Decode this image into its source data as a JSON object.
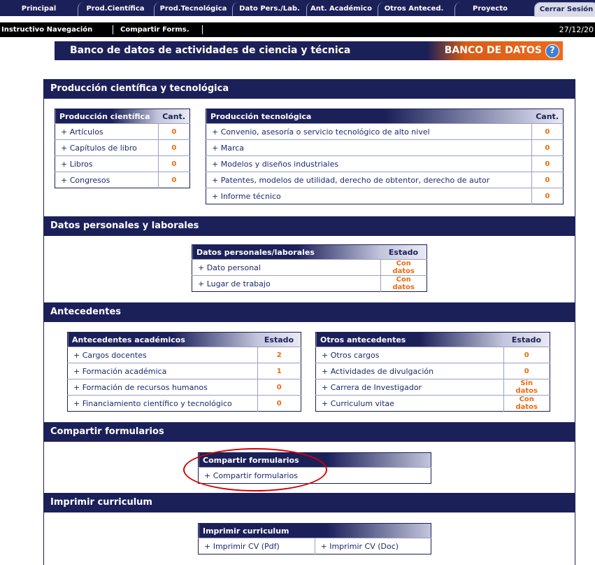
{
  "tabs": [
    {
      "label": "Principal"
    },
    {
      "label": "Prod.Científica"
    },
    {
      "label": "Prod.Tecnológica"
    },
    {
      "label": "Dato Pers./Lab."
    },
    {
      "label": "Ant. Académico"
    },
    {
      "label": "Otros Anteced."
    },
    {
      "label": "Proyecto"
    },
    {
      "label": "Cerrar Sesión"
    }
  ],
  "subbar": {
    "instructivo": "Instructivo Navegación",
    "compartir": "Compartir Forms.",
    "date": "27/12/20"
  },
  "banner": {
    "title": "Banco de datos de actividades de ciencia y técnica",
    "right_label": "BANCO DE DATOS",
    "help": "?"
  },
  "sections": {
    "prod": "Producción científica y tecnológica",
    "datos": "Datos personales y laborales",
    "antecedentes": "Antecedentes",
    "compartir": "Compartir formularios",
    "imprimir": "Imprimir curriculum"
  },
  "prod_cientifica": {
    "header": "Producción científica",
    "col": "Cant.",
    "rows": [
      {
        "label": "+ Artículos",
        "value": "0"
      },
      {
        "label": "+ Capítulos de libro",
        "value": "0"
      },
      {
        "label": "+ Libros",
        "value": "0"
      },
      {
        "label": "+ Congresos",
        "value": "0"
      }
    ]
  },
  "prod_tecnologica": {
    "header": "Producción tecnológica",
    "col": "Cant.",
    "rows": [
      {
        "label": "+ Convenio, asesoría o servicio tecnológico de alto nivel",
        "value": "0"
      },
      {
        "label": "+ Marca",
        "value": "0"
      },
      {
        "label": "+ Modelos y diseños industriales",
        "value": "0"
      },
      {
        "label": "+ Patentes, modelos de utilidad, derecho de obtentor, derecho de autor",
        "value": "0"
      },
      {
        "label": "+ Informe técnico",
        "value": "0"
      }
    ]
  },
  "datos_personales": {
    "header": "Datos personales/laborales",
    "col": "Estado",
    "rows": [
      {
        "label": "+ Dato personal",
        "value": "Con datos"
      },
      {
        "label": "+ Lugar de trabajo",
        "value": "Con datos"
      }
    ]
  },
  "ant_academicos": {
    "header": "Antecedentes académicos",
    "col": "Estado",
    "rows": [
      {
        "label": "+ Cargos docentes",
        "value": "2"
      },
      {
        "label": "+ Formación académica",
        "value": "1"
      },
      {
        "label": "+ Formación de recursos humanos",
        "value": "0"
      },
      {
        "label": "+ Financiamiento científico y tecnológico",
        "value": "0"
      }
    ]
  },
  "otros_ant": {
    "header": "Otros antecedentes",
    "col": "Estado",
    "rows": [
      {
        "label": "+ Otros cargos",
        "value": "0"
      },
      {
        "label": "+ Actividades de divulgación",
        "value": "0"
      },
      {
        "label": "+ Carrera de Investigador",
        "value": "Sin datos"
      },
      {
        "label": "+ Curriculum vitae",
        "value": "Con datos"
      }
    ]
  },
  "compartir_box": {
    "header": "Compartir formularios",
    "link": "+ Compartir formularios"
  },
  "imprimir_box": {
    "header": "Imprimir curriculum",
    "pdf": "+ Imprimir CV (Pdf)",
    "doc": "+ Imprimir CV (Doc)"
  },
  "colors": {
    "navy": "#1c2059",
    "orange": "#ee6a10",
    "highlight_ellipse": "#d40000"
  }
}
